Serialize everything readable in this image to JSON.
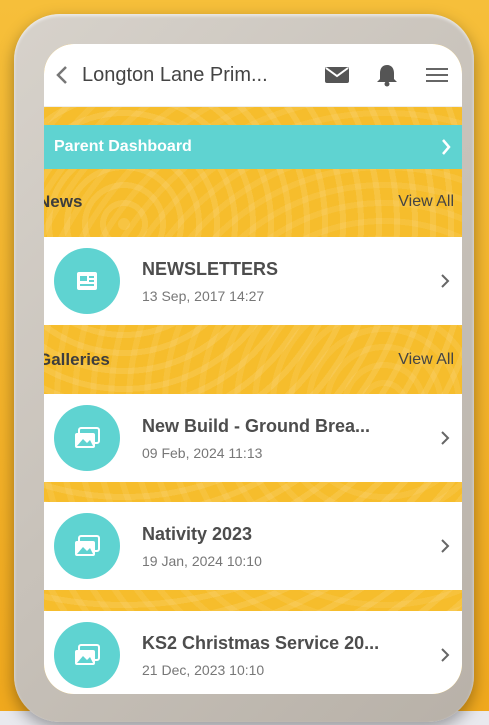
{
  "header": {
    "title": "Longton Lane Prim...",
    "back_icon": "chevron-left-icon",
    "icons": [
      "mail-icon",
      "bell-icon",
      "menu-icon"
    ]
  },
  "dashboard": {
    "label": "Parent Dashboard"
  },
  "news": {
    "title": "News",
    "view_all": "View All",
    "items": [
      {
        "name": "NEWSLETTERS",
        "date": "13 Sep, 2017 14:27",
        "icon": "newspaper-icon"
      }
    ]
  },
  "galleries": {
    "title": "Galleries",
    "view_all": "View All",
    "items": [
      {
        "name": "New Build - Ground Brea...",
        "date": "09 Feb, 2024 11:13",
        "icon": "gallery-icon"
      },
      {
        "name": "Nativity 2023",
        "date": "19 Jan, 2024 10:10",
        "icon": "gallery-icon"
      },
      {
        "name": "KS2 Christmas Service 20...",
        "date": "21 Dec, 2023 10:10",
        "icon": "gallery-icon"
      }
    ]
  },
  "colors": {
    "accent": "#5fd3d1",
    "background": "#f6bd2c"
  }
}
